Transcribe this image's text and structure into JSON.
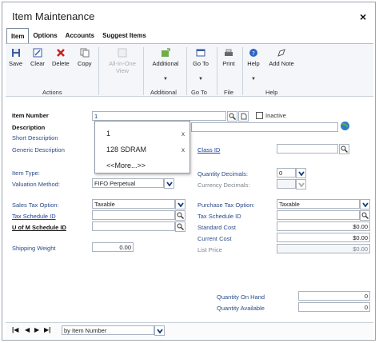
{
  "window": {
    "title": "Item Maintenance",
    "close_glyph": "×"
  },
  "tabs": [
    {
      "label": "Item"
    },
    {
      "label": "Options"
    },
    {
      "label": "Accounts"
    },
    {
      "label": "Suggest Items"
    }
  ],
  "ribbon": {
    "actions": {
      "label": "Actions",
      "save": "Save",
      "clear": "Clear",
      "delete": "Delete",
      "copy": "Copy"
    },
    "all_in_one_view": {
      "line1": "All-In-One",
      "line2": "View"
    },
    "additional": {
      "button": "Additional",
      "group": "Additional"
    },
    "goto": {
      "button": "Go To",
      "group": "Go To"
    },
    "file": {
      "button": "Print",
      "group": "File"
    },
    "help": {
      "help": "Help",
      "add_note": "Add Note",
      "group": "Help"
    },
    "dropdown_glyph": "▼"
  },
  "form": {
    "item_number": {
      "label": "Item Number",
      "value": "1"
    },
    "inactive_label": "Inactive",
    "description_label": "Description",
    "short_description_label": "Short Description",
    "generic_description_label": "Generic Description",
    "class_id_label": "Class ID",
    "item_type_label": "Item Type:",
    "valuation_method": {
      "label": "Valuation Method:",
      "value": "FIFO Perpetual"
    },
    "quantity_decimals": {
      "label": "Quantity Decimals:",
      "value": "0"
    },
    "currency_decimals_label": "Currency Decimals:",
    "sales_tax_option": {
      "label": "Sales Tax Option:",
      "value": "Taxable"
    },
    "tax_schedule_id_label": "Tax Schedule ID",
    "uom_schedule_id_label": "U of M Schedule ID",
    "shipping_weight": {
      "label": "Shipping Weight",
      "value": "0.00"
    },
    "purchase_tax_option": {
      "label": "Purchase Tax Option:",
      "value": "Taxable"
    },
    "purchase_tax_schedule_id_label": "Tax Schedule ID",
    "standard_cost": {
      "label": "Standard Cost",
      "value": "$0.00"
    },
    "current_cost": {
      "label": "Current Cost",
      "value": "$0.00"
    },
    "list_price": {
      "label": "List Price",
      "value": "$0.00"
    },
    "quantity_on_hand": {
      "label": "Quantity On Hand",
      "value": "0"
    },
    "quantity_available": {
      "label": "Quantity Available",
      "value": "0"
    }
  },
  "popup": {
    "items": [
      {
        "label": "1",
        "remove": "x"
      },
      {
        "label": "128 SDRAM",
        "remove": "x"
      }
    ],
    "more": "<<More...>>"
  },
  "navigation": {
    "first": "|◀",
    "prev": "◀",
    "next": "▶",
    "last": "▶|",
    "sort_by": "by Item Number"
  },
  "colors": {
    "link": "#1a3d9e",
    "border": "#a9b3bf",
    "ribbon_bg": "#f4f6f9"
  }
}
